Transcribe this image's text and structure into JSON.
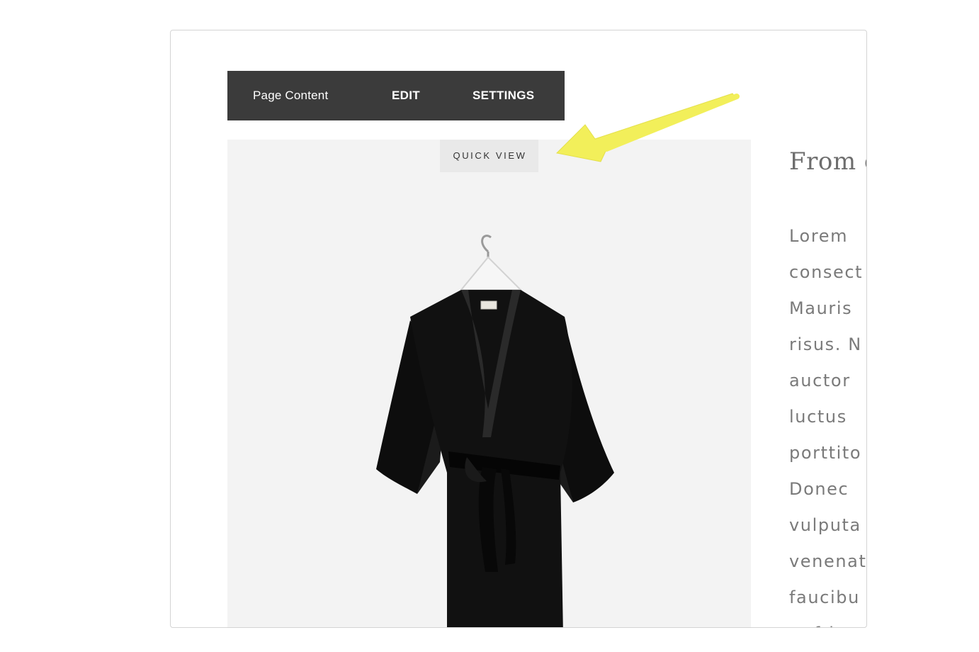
{
  "toolbar": {
    "page_content_label": "Page Content",
    "edit_label": "EDIT",
    "settings_label": "SETTINGS"
  },
  "product": {
    "quick_view_label": "QUICK VIEW",
    "image_icon": "black-wrap-dress-on-hanger"
  },
  "content": {
    "title": "From c",
    "lines": [
      "Lorem",
      "consect",
      "Mauris",
      "risus. N",
      "auctor",
      "luctus",
      "porttito",
      "Donec",
      "vulputa",
      "venenat",
      "faucibu",
      "a, fring"
    ]
  },
  "colors": {
    "toolbar_bg": "#3b3b3b",
    "annotation_arrow": "#f2ef5a",
    "image_bg": "#f3f3f3"
  },
  "annotation": {
    "icon": "yellow-arrow-icon"
  }
}
